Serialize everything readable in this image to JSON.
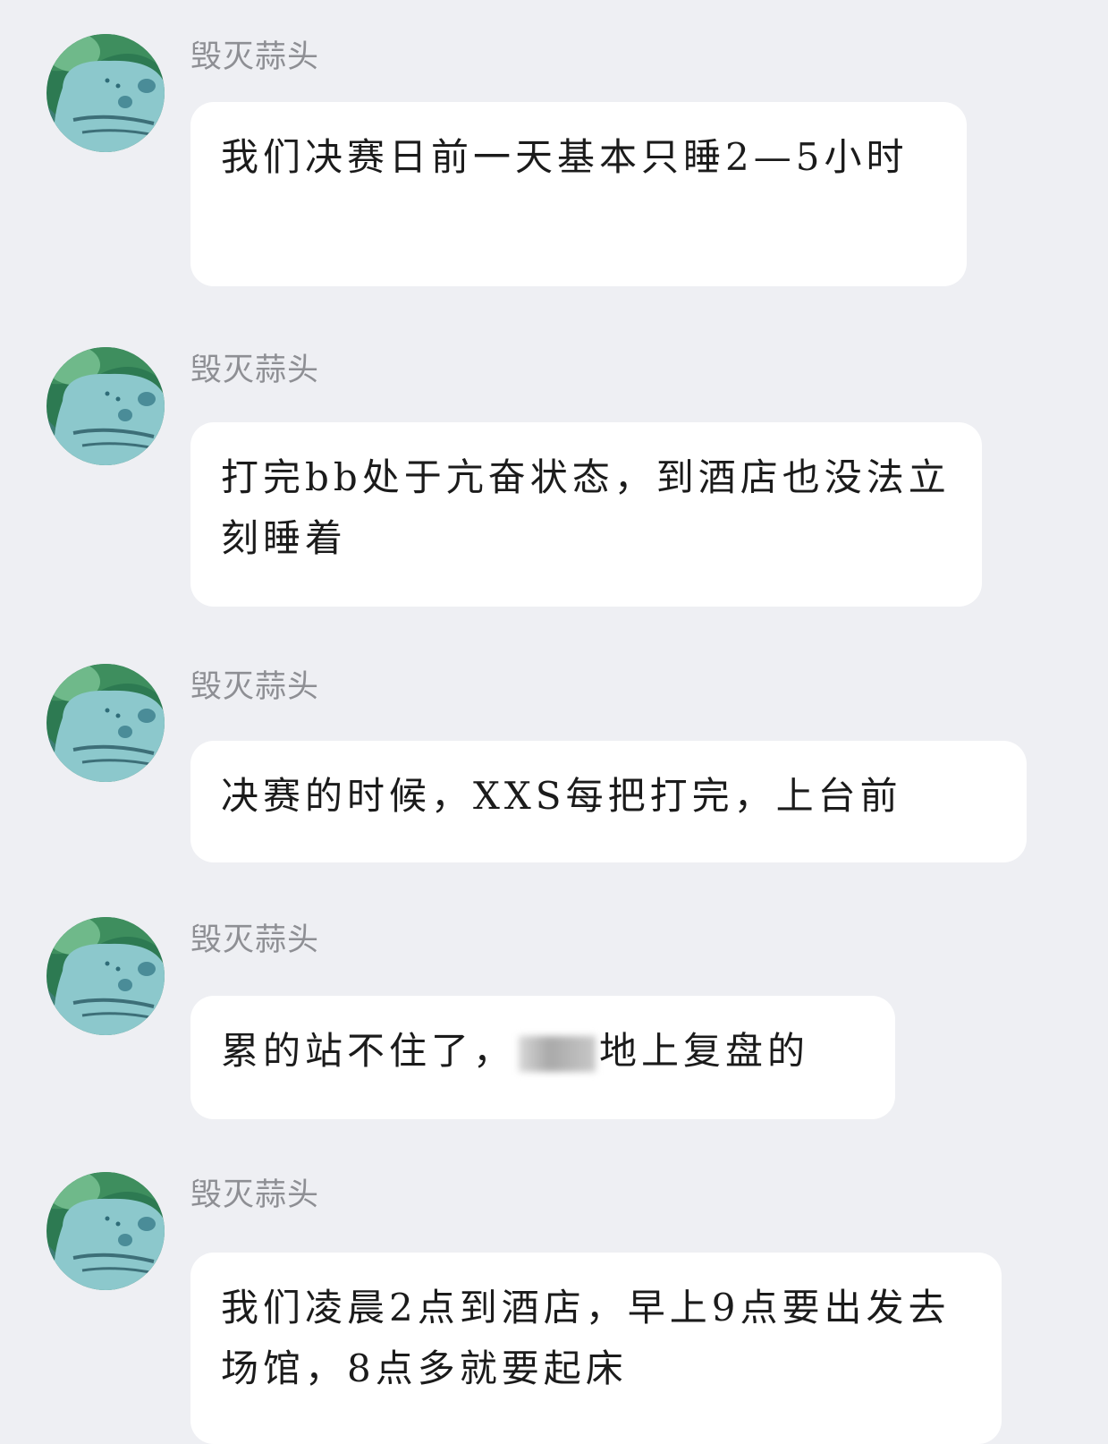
{
  "messages": [
    {
      "sender": "毁灭蒜头",
      "avatar_icon": "bulbasaur-avatar-icon",
      "text": "我们决赛日前一天基本只睡2—5小时"
    },
    {
      "sender": "毁灭蒜头",
      "avatar_icon": "bulbasaur-avatar-icon",
      "text": "打完bb处于亢奋状态，到酒店也没法立刻睡着"
    },
    {
      "sender": "毁灭蒜头",
      "avatar_icon": "bulbasaur-avatar-icon",
      "text": "决赛的时候，XXS每把打完，上台前"
    },
    {
      "sender": "毁灭蒜头",
      "avatar_icon": "bulbasaur-avatar-icon",
      "text_before": "累的站不住了，",
      "text_after": "地上复盘的"
    },
    {
      "sender": "毁灭蒜头",
      "avatar_icon": "bulbasaur-avatar-icon",
      "text": "我们凌晨2点到酒店，早上9点要出发去场馆，8点多就要起床"
    }
  ]
}
